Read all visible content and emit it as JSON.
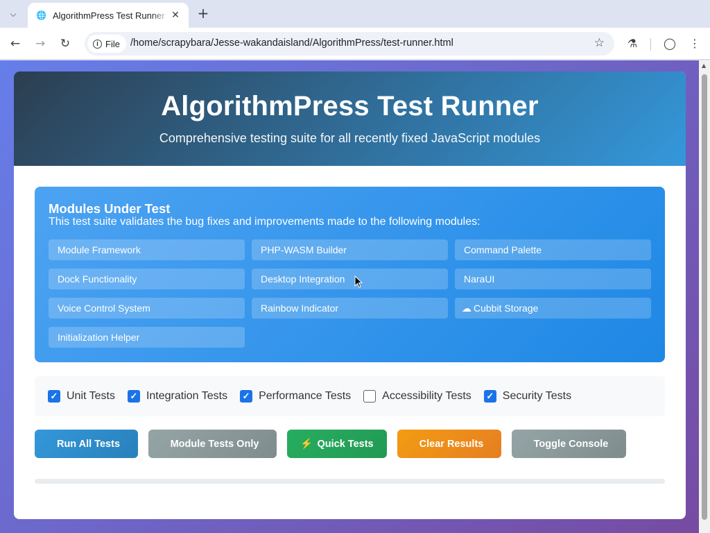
{
  "browser": {
    "tab_title": "AlgorithmPress Test Runner",
    "url_chip": "File",
    "url": "/home/scrapybara/Jesse-wakandaisland/AlgorithmPress/test-runner.html"
  },
  "header": {
    "icon": "",
    "title": "AlgorithmPress Test Runner",
    "subtitle": "Comprehensive testing suite for all recently fixed JavaScript modules"
  },
  "modules": {
    "icon": "",
    "heading": "Modules Under Test",
    "description": "This test suite validates the bug fixes and improvements made to the following modules:",
    "items": [
      {
        "icon": "",
        "label": "Module Framework"
      },
      {
        "icon": "",
        "label": "PHP-WASM Builder"
      },
      {
        "icon": "",
        "label": "Command Palette"
      },
      {
        "icon": "",
        "label": "Dock Functionality"
      },
      {
        "icon": "",
        "label": "Desktop Integration"
      },
      {
        "icon": "",
        "label": "NaraUI"
      },
      {
        "icon": "",
        "label": "Voice Control System"
      },
      {
        "icon": "",
        "label": "Rainbow Indicator"
      },
      {
        "icon": "☁",
        "label": "Cubbit Storage"
      },
      {
        "icon": "",
        "label": "Initialization Helper"
      }
    ]
  },
  "options": [
    {
      "label": "Unit Tests",
      "checked": true
    },
    {
      "label": "Integration Tests",
      "checked": true
    },
    {
      "label": "Performance Tests",
      "checked": true
    },
    {
      "label": "Accessibility Tests",
      "checked": false
    },
    {
      "label": "Security Tests",
      "checked": true
    }
  ],
  "actions": [
    {
      "icon": "",
      "label": "Run All Tests",
      "variant": "primary"
    },
    {
      "icon": "",
      "label": "Module Tests Only",
      "variant": "secondary"
    },
    {
      "icon": "⚡",
      "label": "Quick Tests",
      "variant": "success"
    },
    {
      "icon": "",
      "label": "Clear Results",
      "variant": "warning"
    },
    {
      "icon": "",
      "label": "Toggle Console",
      "variant": "secondary"
    }
  ],
  "progress": {
    "percent": 0
  },
  "colors": {
    "page_gradient": [
      "#667eea",
      "#764ba2"
    ],
    "header_gradient": [
      "#2c3e50",
      "#3498db"
    ],
    "primary": "#3498db",
    "success": "#27ae60",
    "warning": "#f39c12",
    "secondary": "#95a5a6"
  }
}
